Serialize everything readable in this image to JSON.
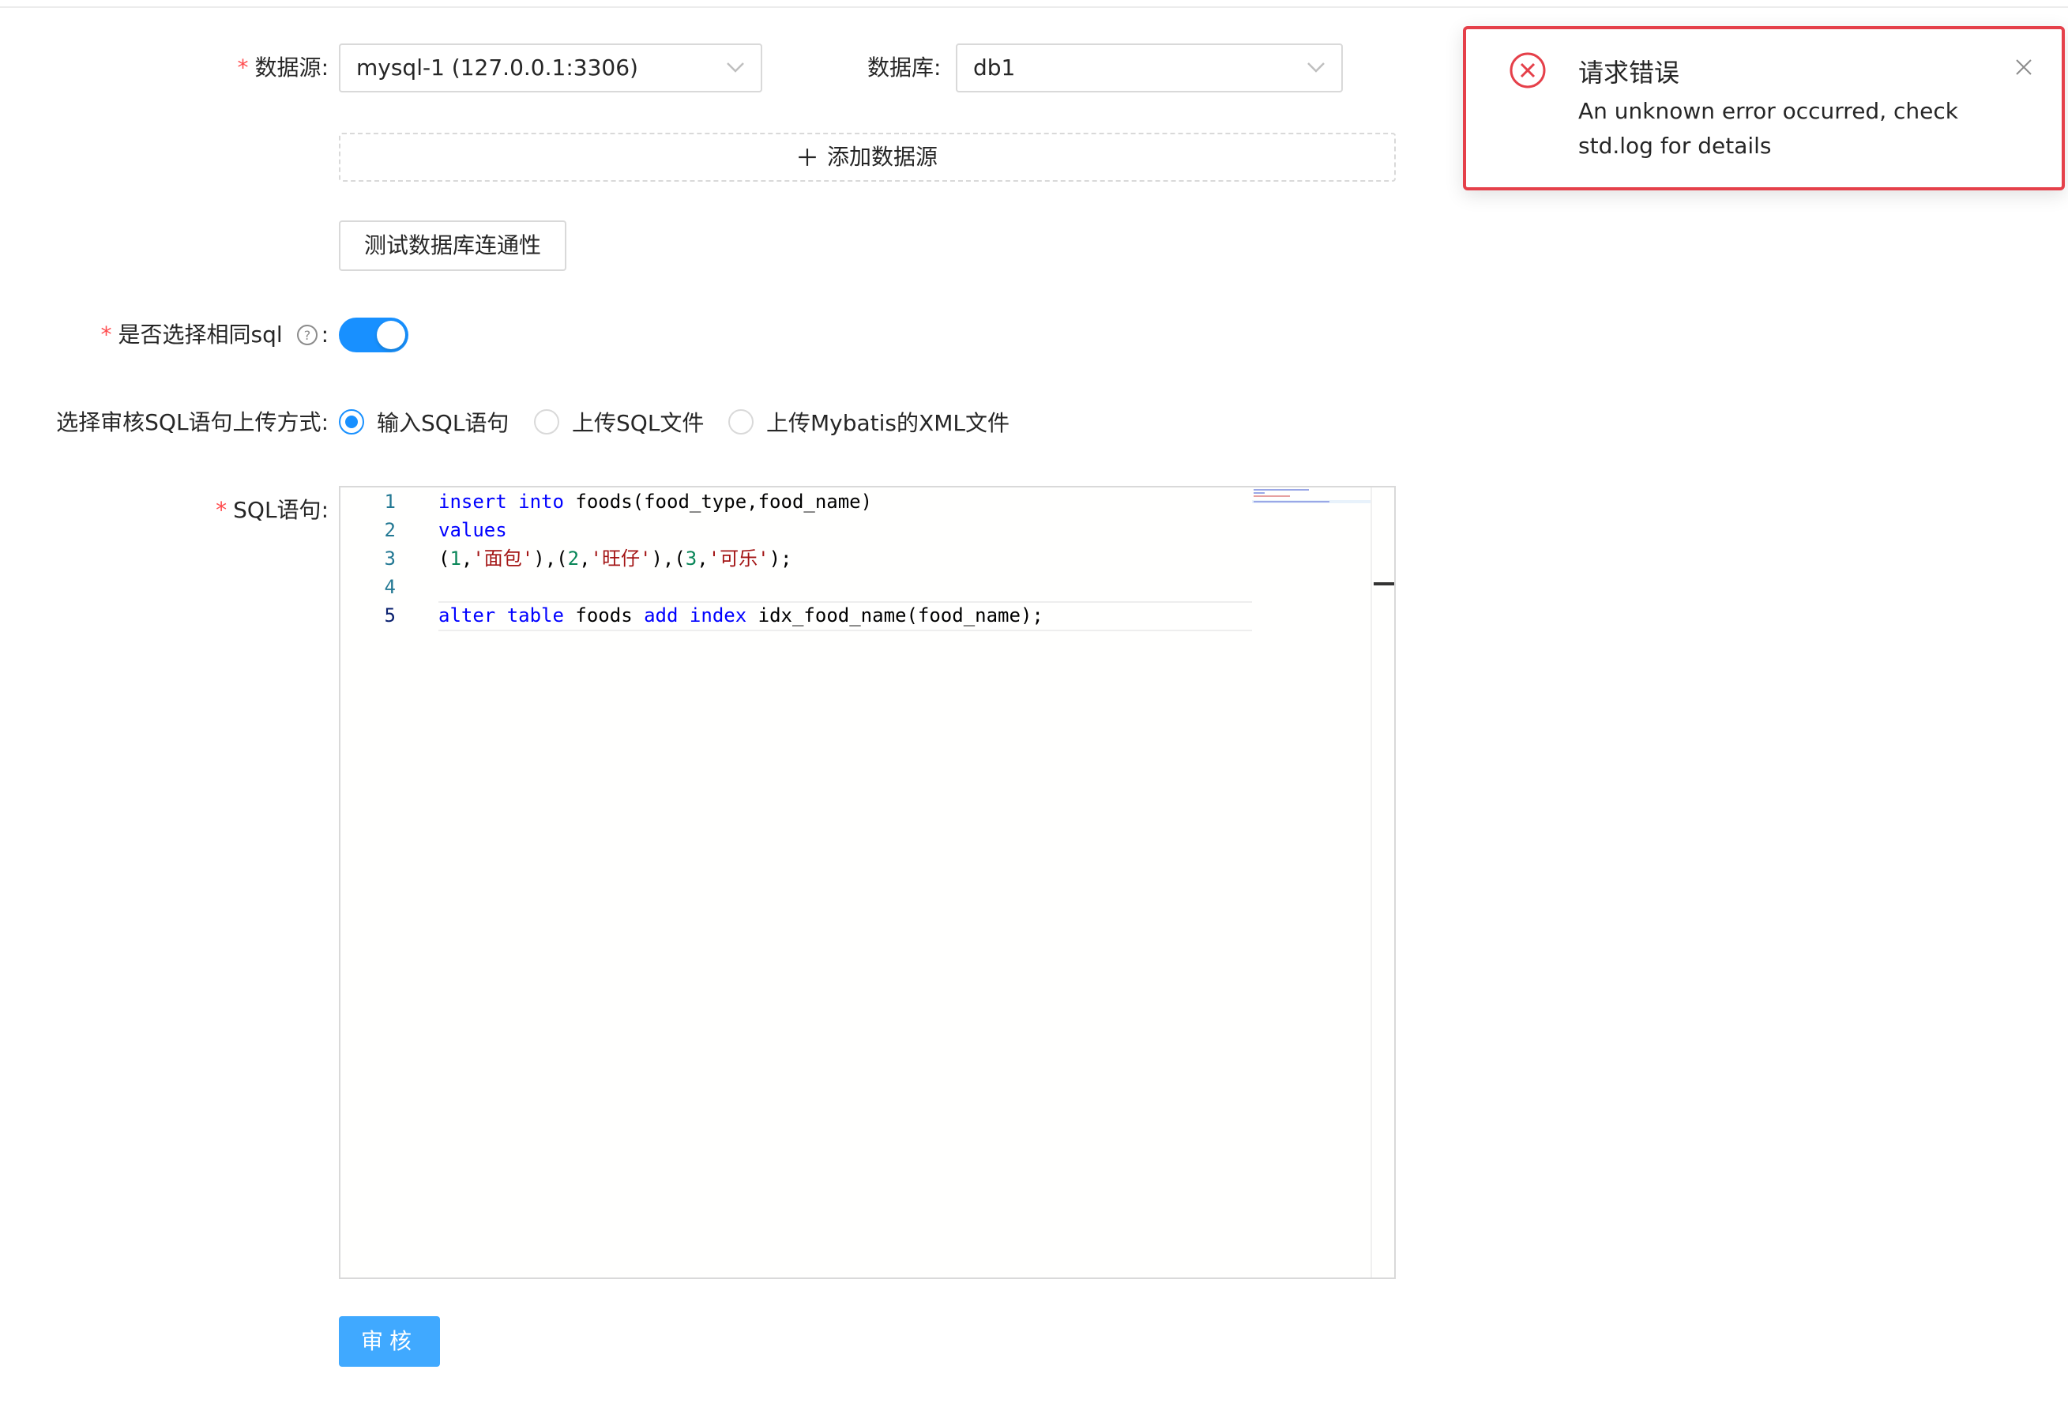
{
  "form": {
    "datasource_label": "数据源",
    "datasource_value": "mysql-1 (127.0.0.1:3306)",
    "database_label": "数据库",
    "database_value": "db1",
    "add_datasource_label": "添加数据源",
    "test_connection_label": "测试数据库连通性",
    "same_sql_label": "是否选择相同sql",
    "same_sql_enabled": true,
    "upload_method_label": "选择审核SQL语句上传方式",
    "upload_options": [
      {
        "label": "输入SQL语句",
        "selected": true
      },
      {
        "label": "上传SQL文件",
        "selected": false
      },
      {
        "label": "上传Mybatis的XML文件",
        "selected": false
      }
    ],
    "sql_label": "SQL语句",
    "colon": ":",
    "submit_label": "审核"
  },
  "editor": {
    "line_numbers": [
      "1",
      "2",
      "3",
      "4",
      "5"
    ],
    "lines": [
      "insert into foods(food_type,food_name)",
      "values",
      "(1,'面包'),(2,'旺仔'),(3,'可乐');",
      "",
      "alter table foods add index idx_food_name(food_name);"
    ]
  },
  "notification": {
    "title": "请求错误",
    "message": "An unknown error occurred, check std.log for details"
  },
  "colors": {
    "primary": "#1890ff",
    "submit": "#40a9ff",
    "error": "#e5404a",
    "required": "#ff4d4f"
  },
  "icons": {
    "error": "error-circle-icon",
    "close": "close-icon",
    "plus": "plus-icon",
    "help": "question-circle-icon",
    "dropdown": "chevron-down-icon"
  }
}
